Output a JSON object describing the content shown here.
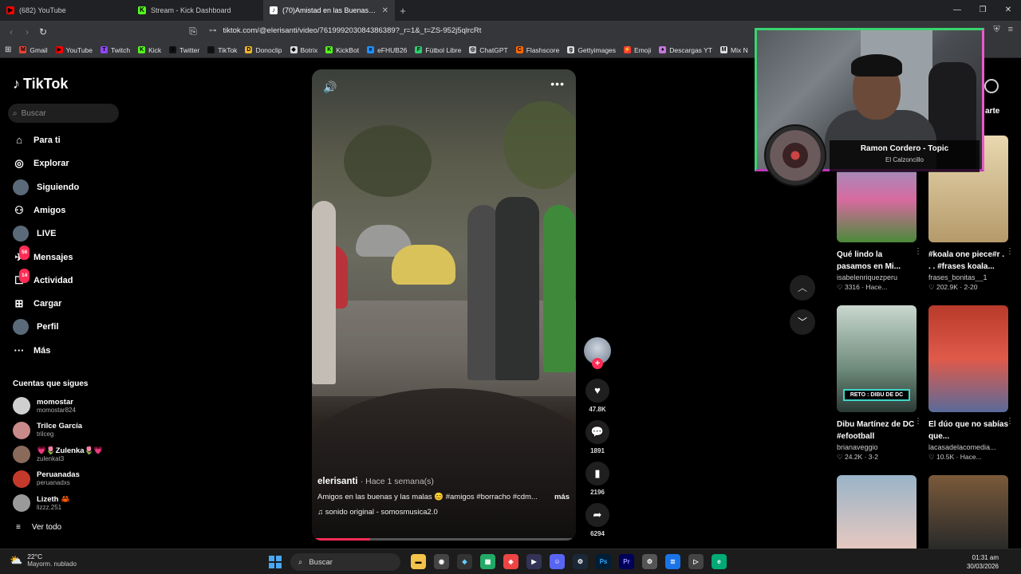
{
  "browser": {
    "tabs": [
      {
        "label": "(682) YouTube",
        "icon": "youtube-icon",
        "color": "#ff0000",
        "glyph": "▶",
        "active": false
      },
      {
        "label": "Stream - Kick Dashboard",
        "icon": "kick-icon",
        "color": "#53fc18",
        "glyph": "K",
        "active": false
      },
      {
        "label": "(70)Amistad en las Buenas y las",
        "icon": "tiktok-icon",
        "color": "#ffffff",
        "glyph": "♪",
        "active": true
      }
    ],
    "url_host": "tiktok.com",
    "url_path": "/@elerisanti/video/761999203084386389?_r=1&_t=ZS-952j5qlrcRt"
  },
  "bookmarks": [
    {
      "label": "Gmail",
      "color": "#ea4335",
      "glyph": "M"
    },
    {
      "label": "YouTube",
      "color": "#ff0000",
      "glyph": "▶"
    },
    {
      "label": "Twitch",
      "color": "#9146ff",
      "glyph": "T"
    },
    {
      "label": "Kick",
      "color": "#53fc18",
      "glyph": "K"
    },
    {
      "label": "Twitter",
      "color": "#111111",
      "glyph": "X"
    },
    {
      "label": "TikTok",
      "color": "#111111",
      "glyph": "♪"
    },
    {
      "label": "Donoclip",
      "color": "#f0b429",
      "glyph": "D"
    },
    {
      "label": "Botrix",
      "color": "#dddddd",
      "glyph": "◆"
    },
    {
      "label": "KickBot",
      "color": "#53fc18",
      "glyph": "K"
    },
    {
      "label": "eFHUB26",
      "color": "#1e90ff",
      "glyph": "e"
    },
    {
      "label": "Fútbol Libre",
      "color": "#2ecc71",
      "glyph": "F"
    },
    {
      "label": "ChatGPT",
      "color": "#cccccc",
      "glyph": "◎"
    },
    {
      "label": "Flashscore",
      "color": "#ff6600",
      "glyph": "C"
    },
    {
      "label": "Gettyimages",
      "color": "#dddddd",
      "glyph": "g"
    },
    {
      "label": "Emoji",
      "color": "#ff3b30",
      "glyph": "⚡"
    },
    {
      "label": "Descargas YT",
      "color": "#c678dd",
      "glyph": "♦"
    },
    {
      "label": "Mix N",
      "color": "#dddddd",
      "glyph": "M"
    }
  ],
  "sidebar": {
    "brand": "TikTok",
    "search_placeholder": "Buscar",
    "nav": [
      {
        "label": "Para ti",
        "icon": "home-icon",
        "glyph": "⌂",
        "badge": ""
      },
      {
        "label": "Explorar",
        "icon": "compass-icon",
        "glyph": "◎",
        "badge": ""
      },
      {
        "label": "Siguiendo",
        "icon": "following-avatar-icon",
        "glyph": "●",
        "badge": ""
      },
      {
        "label": "Amigos",
        "icon": "friends-icon",
        "glyph": "⚇",
        "badge": ""
      },
      {
        "label": "LIVE",
        "icon": "live-avatar-icon",
        "glyph": "●",
        "badge": ""
      },
      {
        "label": "Mensajes",
        "icon": "messages-icon",
        "glyph": "✈",
        "badge": "56"
      },
      {
        "label": "Actividad",
        "icon": "activity-icon",
        "glyph": "☐",
        "badge": "14"
      },
      {
        "label": "Cargar",
        "icon": "upload-icon",
        "glyph": "⊞",
        "badge": ""
      },
      {
        "label": "Perfil",
        "icon": "profile-avatar-icon",
        "glyph": "●",
        "badge": ""
      },
      {
        "label": "Más",
        "icon": "more-dots-icon",
        "glyph": "···",
        "badge": ""
      }
    ],
    "following_title": "Cuentas que sigues",
    "accounts": [
      {
        "name": "momostar",
        "handle": "momostar824",
        "color": "#cfcfcf"
      },
      {
        "name": "Trilce García",
        "handle": "trilceg",
        "color": "#c98a8a"
      },
      {
        "name": "💗🌷Zulenka🌷💗",
        "handle": "zulenkat3",
        "color": "#8a6a5a"
      },
      {
        "name": "Peruanadas",
        "handle": "peruanadxs",
        "color": "#c43a2a"
      },
      {
        "name": "Lizeth 🦀",
        "handle": "lizzz.251",
        "color": "#9a9a9a"
      }
    ],
    "see_all": "Ver todo"
  },
  "video": {
    "author": "elerisanti",
    "time": "· Hace 1 semana(s)",
    "description": "Amigos en las buenas y las malas 😊 #amigos #borracho #cdm...",
    "more": "más",
    "music": "♫  sonido original - somosmusica2.0",
    "progress": 0.22
  },
  "actions": {
    "likes": "47.8K",
    "comments": "1891",
    "saves": "2196",
    "shares": "6294"
  },
  "recommendations": [
    {
      "title": "Qué lindo la pasamos en Mi...",
      "user": "isabelenriquezperu",
      "meta": "♡ 3316  · Hace...",
      "bg": "linear-gradient(180deg,#6ab0d8,#d86aa0 60%,#4a8a3a)"
    },
    {
      "title": "#koala one piece#r . . . #frases koala...",
      "user": "frases_bonitas__1",
      "meta": "♡ 202.9K · 2-20",
      "bg": "linear-gradient(180deg,#e9d8b0,#b59a6a)"
    },
    {
      "title": "Dibu Martínez de DC #efootball",
      "user": "brianaveggio",
      "meta": "♡ 24.2K · 3-2",
      "bg": "linear-gradient(180deg,#c9d7cf,#6d8a7a 60%,#2a3a35)",
      "label": "RETO : DIBU DE DC"
    },
    {
      "title": "El dúo que no sabías que...",
      "user": "lacasadelacomedia...",
      "meta": "♡ 10.5K · Hace...",
      "bg": "linear-gradient(180deg,#b83a2a,#e05a4a 50%,#5a6a9a)"
    },
    {
      "title": "",
      "user": "",
      "meta": "",
      "bg": "linear-gradient(180deg,#9ab4c8,#e6c8c0)"
    },
    {
      "title": "",
      "user": "",
      "meta": "",
      "bg": "linear-gradient(180deg,#7a5a3a,#2a2a2a)"
    }
  ],
  "overlay": {
    "now_playing_title": "Ramon Cordero - Topic",
    "now_playing_sub": "El Calzoncillo",
    "share_partial": "arte"
  },
  "taskbar": {
    "temp": "22°C",
    "weather": "Mayorm. nublado",
    "search": "Buscar",
    "time": "01:31 am",
    "date": "30/03/2026"
  }
}
